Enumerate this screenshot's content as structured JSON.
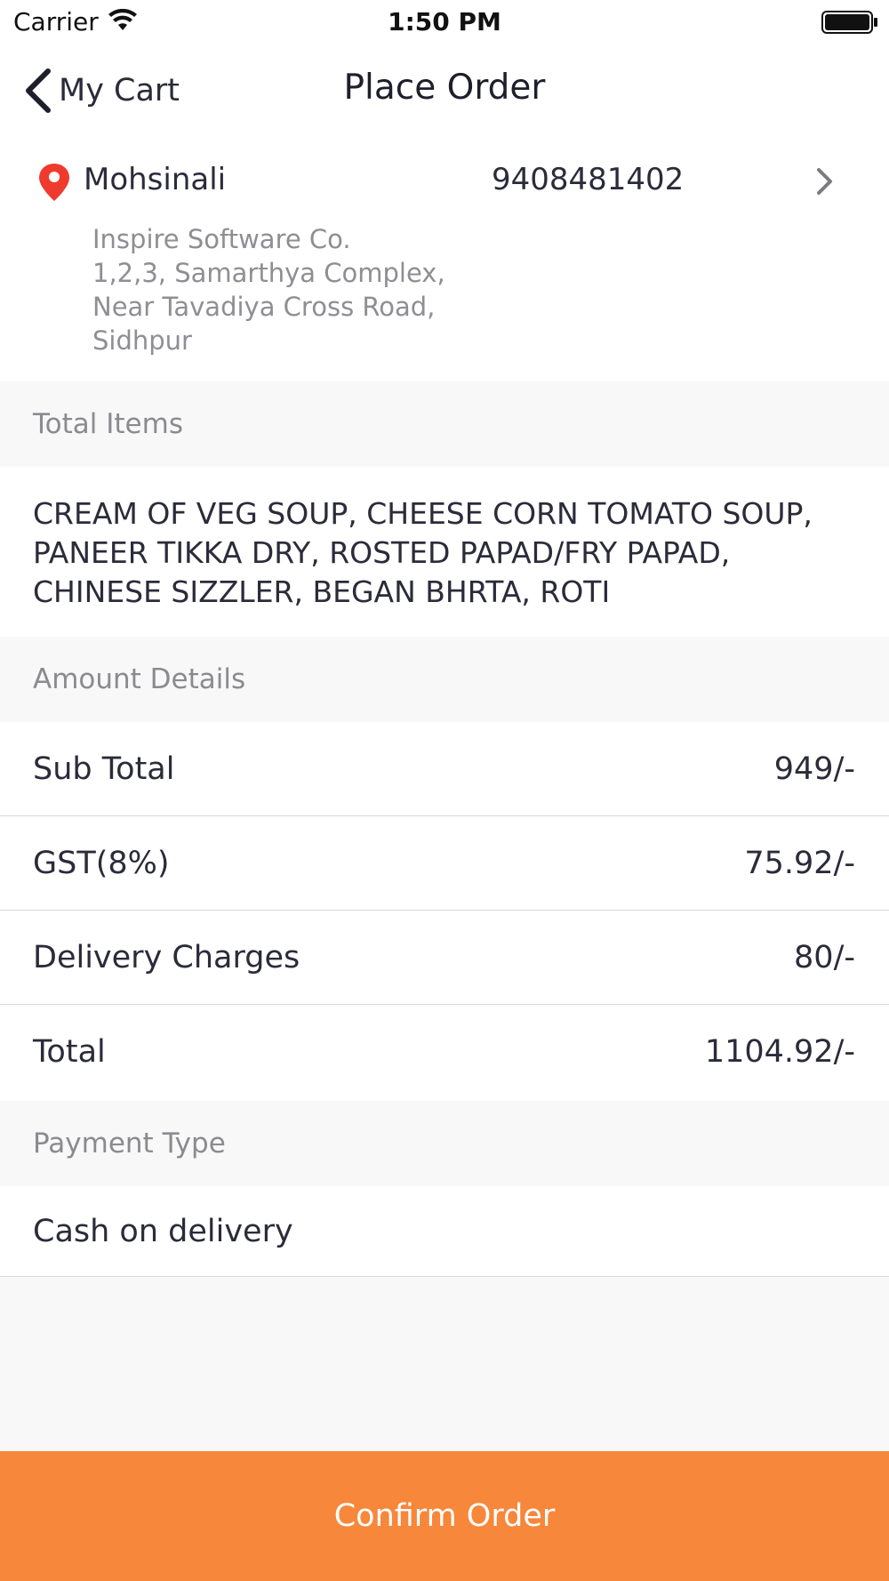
{
  "status_bar": {
    "carrier": "Carrier",
    "time": "1:50 PM"
  },
  "nav": {
    "back_label": "My Cart",
    "title": "Place Order"
  },
  "address": {
    "name": "Mohsinali",
    "phone": "9408481402",
    "lines": [
      "Inspire Software Co.",
      "1,2,3, Samarthya Complex,",
      "Near Tavadiya Cross Road,",
      "Sidhpur"
    ],
    "pin_color": "#ef3b2d"
  },
  "sections": {
    "total_items": "Total Items",
    "amount_details": "Amount Details",
    "payment_type": "Payment Type"
  },
  "items_text": "CREAM OF VEG SOUP, CHEESE CORN TOMATO SOUP, PANEER TIKKA DRY, ROSTED PAPAD/FRY PAPAD, CHINESE SIZZLER, BEGAN BHRTA, ROTI",
  "amounts": [
    {
      "label": "Sub Total",
      "value": "949/-"
    },
    {
      "label": "GST(8%)",
      "value": "75.92/-"
    },
    {
      "label": "Delivery Charges",
      "value": "80/-"
    },
    {
      "label": "Total",
      "value": "1104.92/-"
    }
  ],
  "payment": {
    "method": "Cash on delivery"
  },
  "confirm_label": "Confirm Order",
  "colors": {
    "accent": "#f7873a",
    "section_bg": "#f8f8f8"
  }
}
